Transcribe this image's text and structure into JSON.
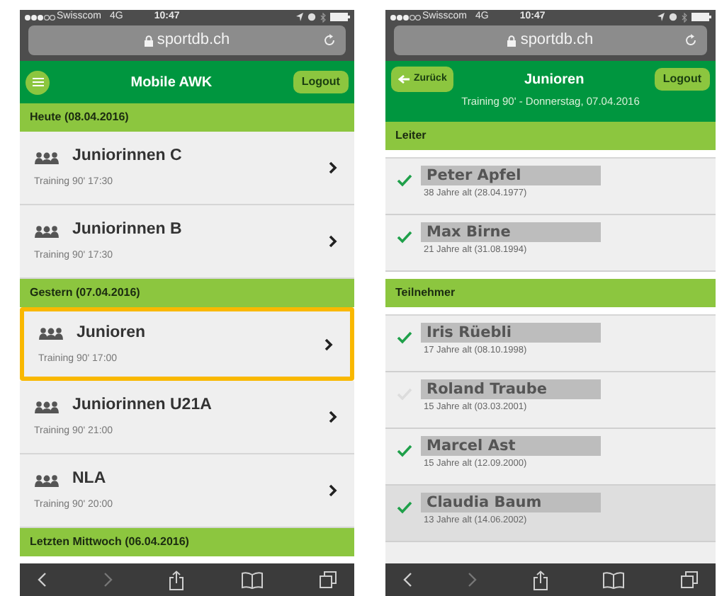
{
  "screens": [
    {
      "kind": "list",
      "status_bar": {
        "carrier": "Swisscom",
        "network": "4G",
        "time": "10:47"
      },
      "address_bar": {
        "url": "sportdb.ch"
      },
      "header": {
        "title": "Mobile AWK",
        "logout": "Logout"
      },
      "sections": [
        {
          "title": "Heute (08.04.2016)",
          "items": [
            {
              "title": "Juniorinnen C",
              "subtitle": "Training 90' 17:30",
              "selected": false
            },
            {
              "title": "Juniorinnen B",
              "subtitle": "Training 90' 17:30",
              "selected": false
            }
          ]
        },
        {
          "title": "Gestern (07.04.2016)",
          "items": [
            {
              "title": "Junioren",
              "subtitle": "Training 90' 17:00",
              "selected": true
            },
            {
              "title": "Juniorinnen U21A",
              "subtitle": "Training 90' 21:00",
              "selected": false
            },
            {
              "title": "NLA",
              "subtitle": "Training 90' 20:00",
              "selected": false
            }
          ]
        },
        {
          "title": "Letzten Mittwoch (06.04.2016)"
        }
      ]
    },
    {
      "kind": "detail",
      "status_bar": {
        "carrier": "Swisscom",
        "network": "4G",
        "time": "10:47"
      },
      "address_bar": {
        "url": "sportdb.ch"
      },
      "header": {
        "back": "Zurück",
        "title": "Junioren",
        "subtitle": "Training 90' - Donnerstag, 07.04.2016",
        "logout": "Logout"
      },
      "sections": [
        {
          "title": "Leiter",
          "items": [
            {
              "title": "Peter Apfel",
              "subtitle": "38 Jahre alt (28.04.1977)",
              "checked": true,
              "selected": false
            },
            {
              "title": "Max Birne",
              "subtitle": "21 Jahre alt (31.08.1994)",
              "checked": true,
              "selected": false
            }
          ]
        },
        {
          "title": "Teilnehmer",
          "items": [
            {
              "title": "Iris Rüebli",
              "subtitle": "17 Jahre alt (08.10.1998)",
              "checked": true,
              "selected": false
            },
            {
              "title": "Roland Traube",
              "subtitle": "15 Jahre alt (03.03.2001)",
              "checked": false,
              "selected": false
            },
            {
              "title": "Marcel Ast",
              "subtitle": "15 Jahre alt (12.09.2000)",
              "checked": true,
              "selected": false
            },
            {
              "title": "Claudia Baum",
              "subtitle": "13 Jahre alt (14.06.2002)",
              "checked": true,
              "selected": true
            }
          ]
        }
      ]
    }
  ]
}
